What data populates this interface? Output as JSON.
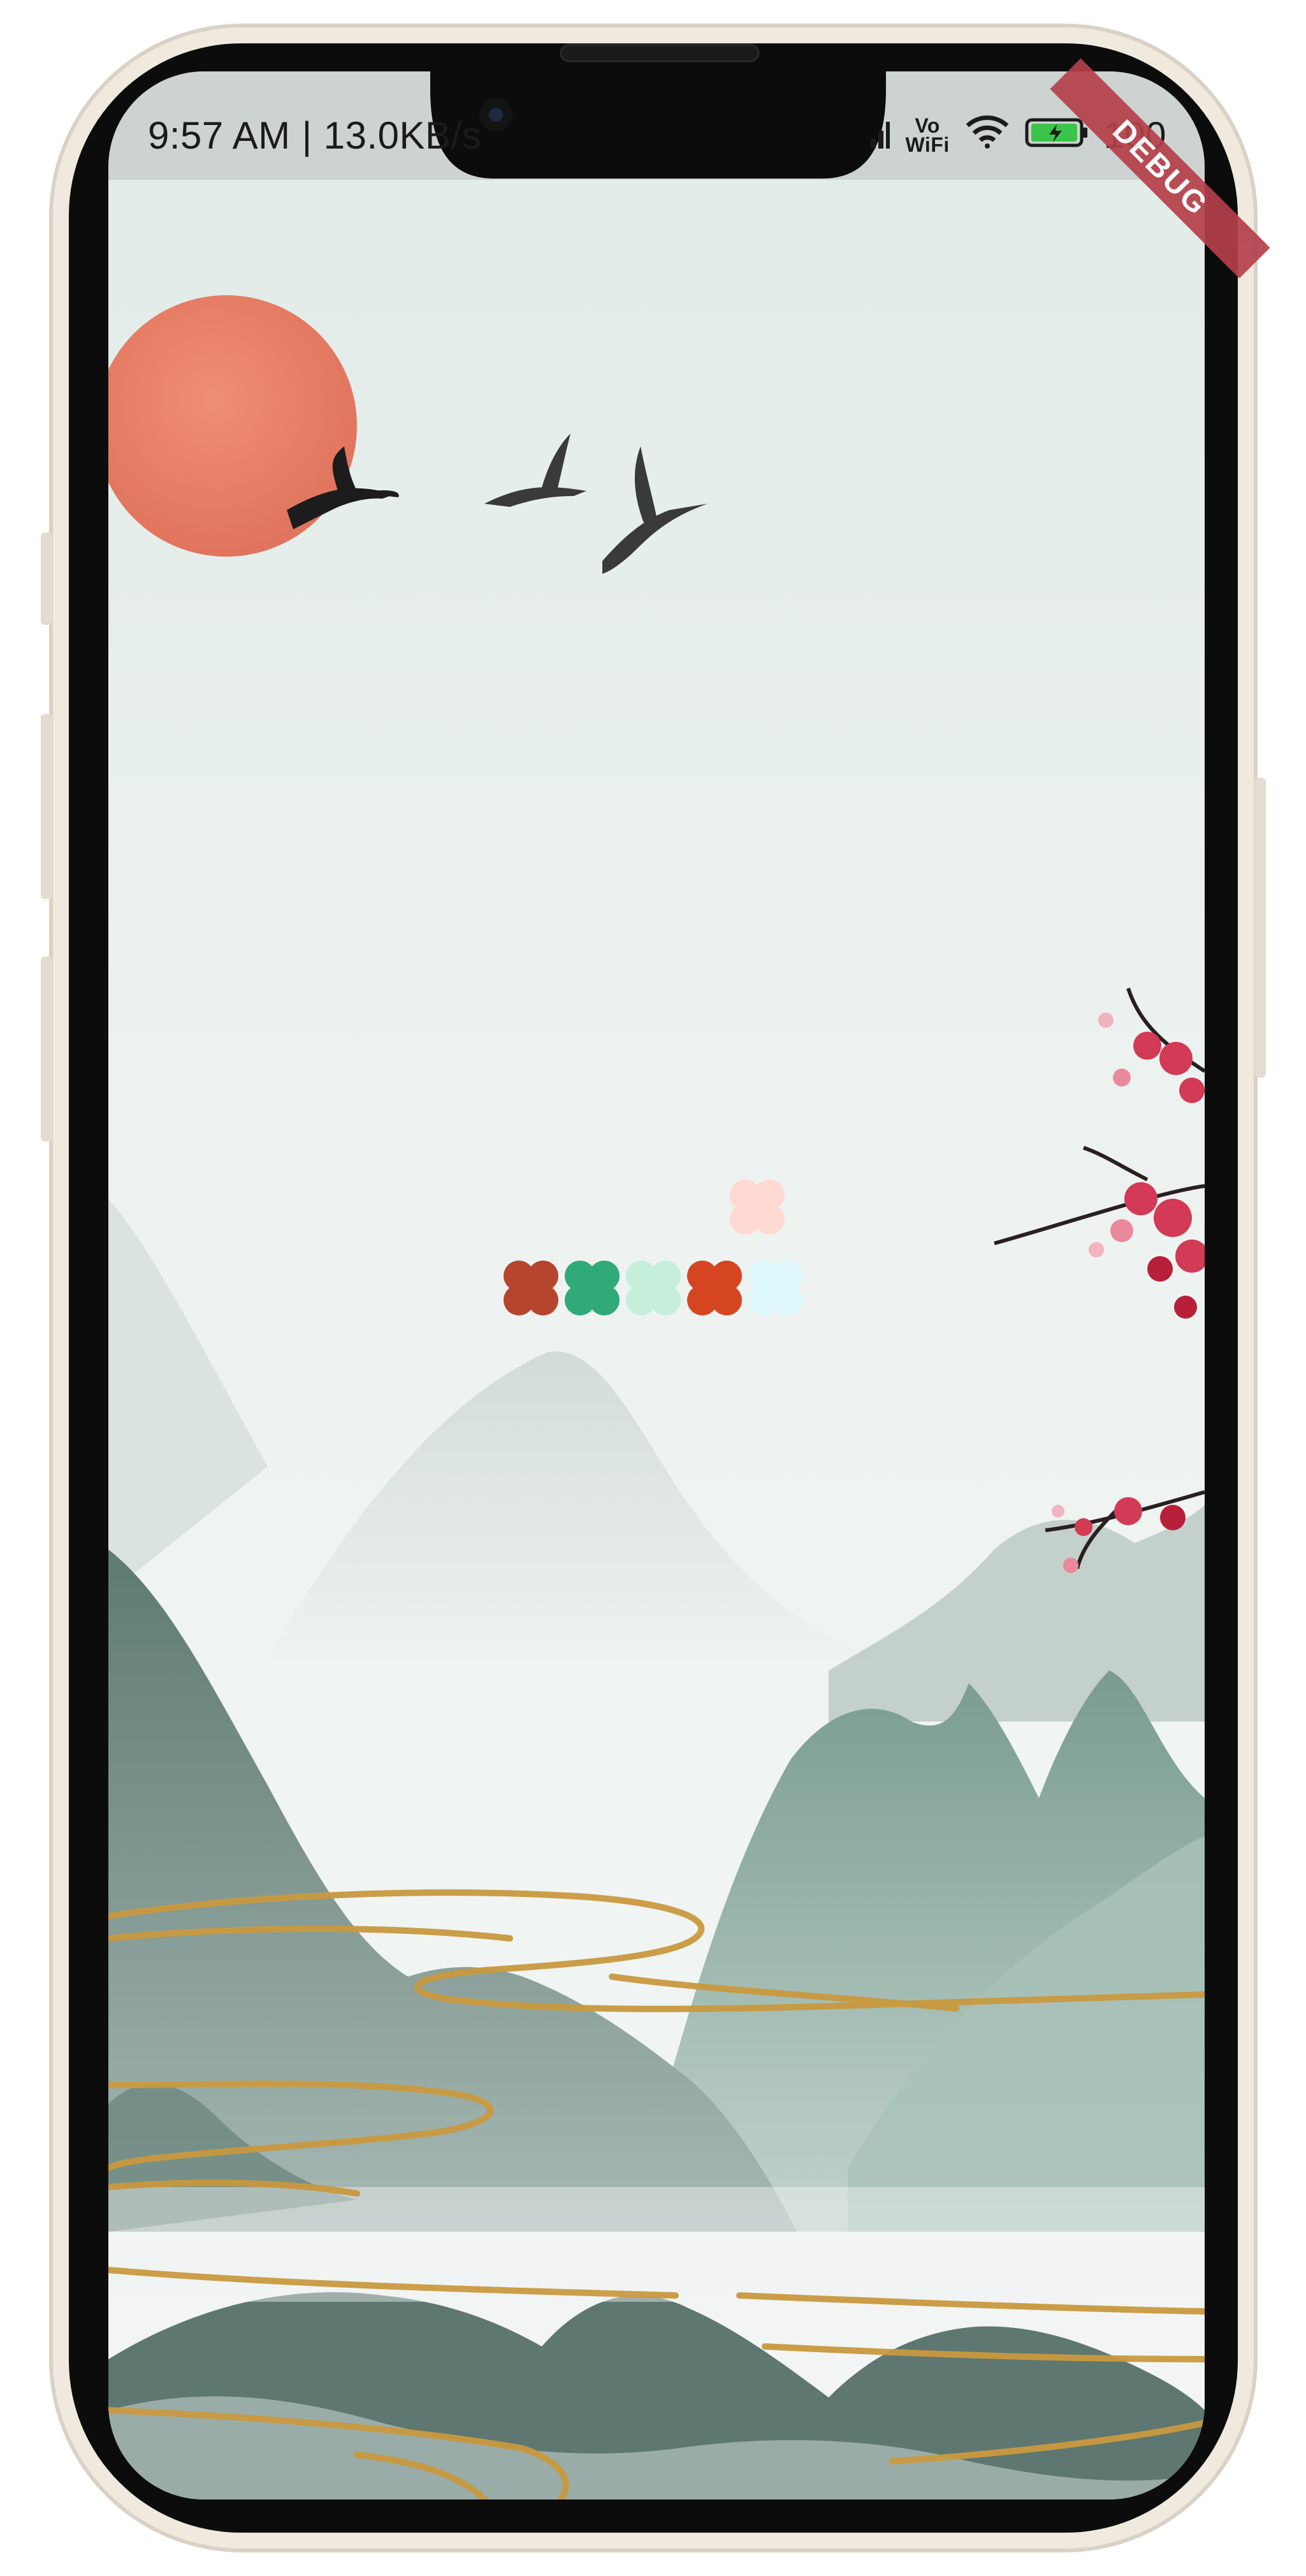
{
  "status_bar": {
    "time": "9:57 AM",
    "separator": "|",
    "net_speed": "13.0KB/s",
    "vowifi_line1": "Vo",
    "vowifi_line2": "WiFi",
    "battery_percent": "100"
  },
  "debug_banner": {
    "label": "DEBUG"
  },
  "flower_tiles": {
    "row_colors": [
      "#b5452c",
      "#2faa78",
      "#c5eedd",
      "#d64521",
      "#ddf8fa"
    ],
    "top_color": "#ffd9d2"
  },
  "colors": {
    "sky": "#e3ece8",
    "sun": "#e87a5e",
    "mountain_dark": "#4f6b63",
    "mountain_mid": "#7f9d93",
    "gold": "#c9993f",
    "blossom": "#d23a55",
    "phone_body": "#efe9de",
    "bezel": "#0c0c0c"
  },
  "icons": [
    "signal-icon",
    "wifi-icon",
    "battery-icon",
    "camera-icon",
    "crane-icon",
    "plum-blossom-icon",
    "sun-icon"
  ]
}
